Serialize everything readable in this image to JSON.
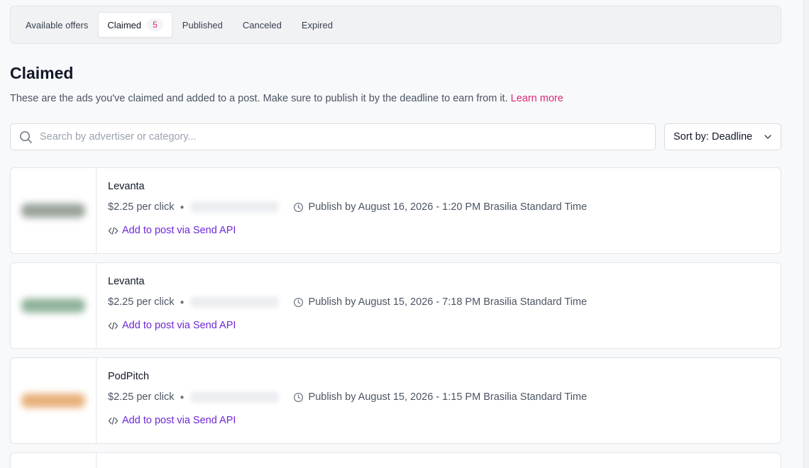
{
  "tabs": [
    {
      "label": "Available offers",
      "active": false
    },
    {
      "label": "Claimed",
      "active": true,
      "badge": "5"
    },
    {
      "label": "Published",
      "active": false
    },
    {
      "label": "Canceled",
      "active": false
    },
    {
      "label": "Expired",
      "active": false
    }
  ],
  "header": {
    "title": "Claimed",
    "description": "These are the ads you've claimed and added to a post. Make sure to publish it by the deadline to earn from it.",
    "learn_more": "Learn more"
  },
  "search": {
    "placeholder": "Search by advertiser or category...",
    "value": ""
  },
  "sort": {
    "label": "Sort by: Deadline"
  },
  "offers": [
    {
      "advertiser": "Levanta",
      "rate": "$2.25 per click",
      "deadline": "Publish by August 16, 2026 - 1:20 PM Brasilia Standard Time",
      "action": "Add to post via Send API",
      "logo_color": "#9aa39b"
    },
    {
      "advertiser": "Levanta",
      "rate": "$2.25 per click",
      "deadline": "Publish by August 15, 2026 - 7:18 PM Brasilia Standard Time",
      "action": "Add to post via Send API",
      "logo_color": "#8fb39a"
    },
    {
      "advertiser": "PodPitch",
      "rate": "$2.25 per click",
      "deadline": "Publish by August 15, 2026 - 1:15 PM Brasilia Standard Time",
      "action": "Add to post via Send API",
      "logo_color": "#e8b07a"
    },
    {
      "advertiser": "",
      "rate": "",
      "deadline": "",
      "action": "",
      "logo_color": "#cccccc"
    }
  ],
  "colors": {
    "accent": "#db2777",
    "link": "#6d28d9"
  }
}
